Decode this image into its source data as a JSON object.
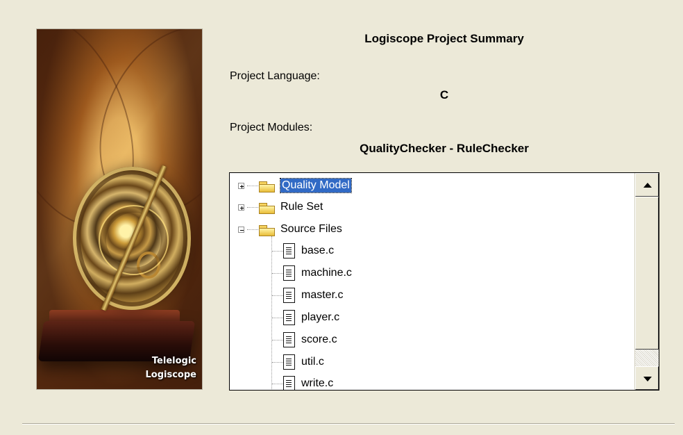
{
  "image": {
    "brand_line1": "Telelogic",
    "brand_line2": "Logiscope"
  },
  "summary": {
    "title": "Logiscope Project Summary",
    "language_label": "Project Language:",
    "language_value": "C",
    "modules_label": "Project Modules:",
    "modules_value": "QualityChecker - RuleChecker"
  },
  "tree": {
    "items": [
      {
        "label": "Quality Model",
        "expanded": false,
        "selected": true,
        "icon": "folder-icon"
      },
      {
        "label": "Rule Set",
        "expanded": false,
        "selected": false,
        "icon": "folder-icon"
      },
      {
        "label": "Source Files",
        "expanded": true,
        "selected": false,
        "icon": "folder-icon"
      },
      {
        "label": "base.c",
        "icon": "file-icon"
      },
      {
        "label": "machine.c",
        "icon": "file-icon"
      },
      {
        "label": "master.c",
        "icon": "file-icon"
      },
      {
        "label": "player.c",
        "icon": "file-icon"
      },
      {
        "label": "score.c",
        "icon": "file-icon"
      },
      {
        "label": "util.c",
        "icon": "file-icon"
      },
      {
        "label": "write.c",
        "icon": "file-icon"
      }
    ]
  },
  "icons": {
    "scroll_up": "up-arrow-icon",
    "scroll_down": "down-arrow-icon",
    "expand": "plus-expander-icon",
    "collapse": "minus-expander-icon"
  },
  "colors": {
    "dialog_background": "#ece9d8",
    "selection": "#316ac5",
    "tree_background": "#ffffff"
  }
}
